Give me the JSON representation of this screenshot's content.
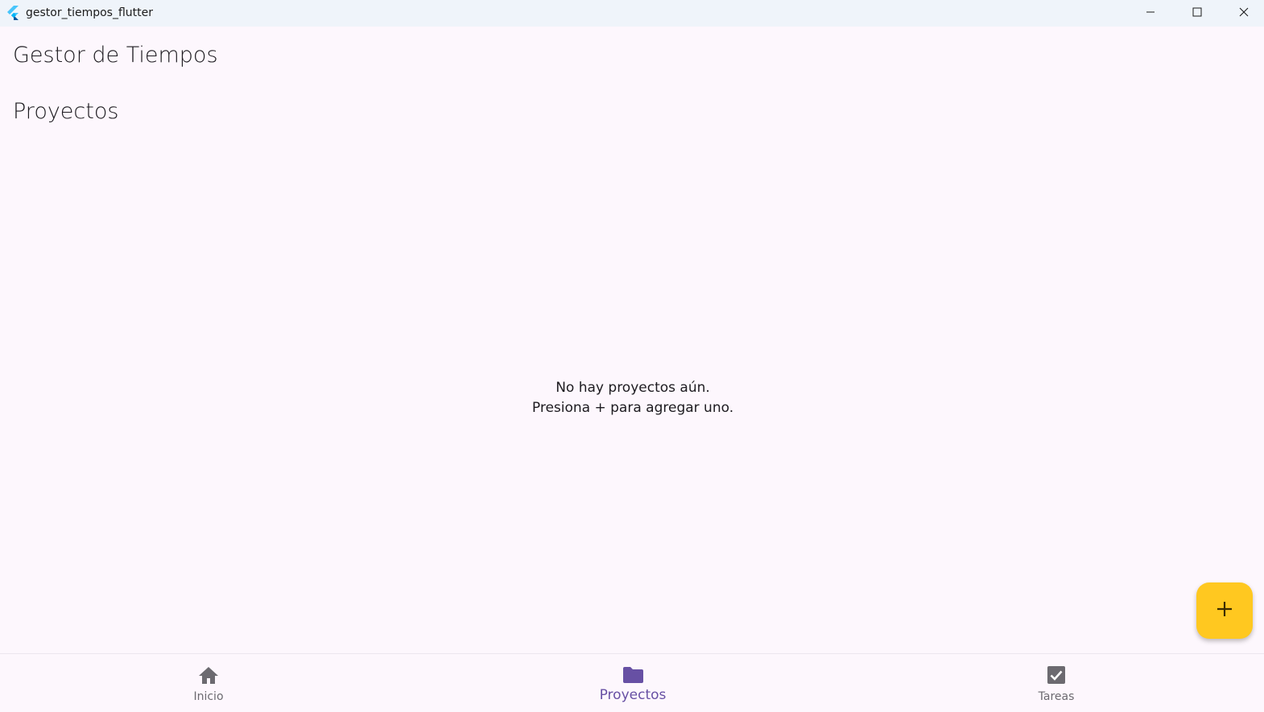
{
  "window": {
    "title": "gestor_tiempos_flutter",
    "icon": "flutter-logo",
    "controls": [
      "minimize-icon",
      "maximize-icon",
      "close-icon"
    ]
  },
  "app_bar": {
    "title": "Gestor de Tiempos"
  },
  "section": {
    "title": "Proyectos"
  },
  "empty_state": {
    "line1": "No hay proyectos aún.",
    "line2": "Presiona + para agregar uno."
  },
  "fab": {
    "icon": "add-icon",
    "color": "#ffc820"
  },
  "bottom_nav": {
    "items": [
      {
        "label": "Inicio",
        "icon": "home-icon",
        "active": false
      },
      {
        "label": "Proyectos",
        "icon": "folder-icon",
        "active": true
      },
      {
        "label": "Tareas",
        "icon": "check-box-icon",
        "active": false
      }
    ],
    "active_color": "#6750a4",
    "inactive_color": "#6c6a70"
  }
}
